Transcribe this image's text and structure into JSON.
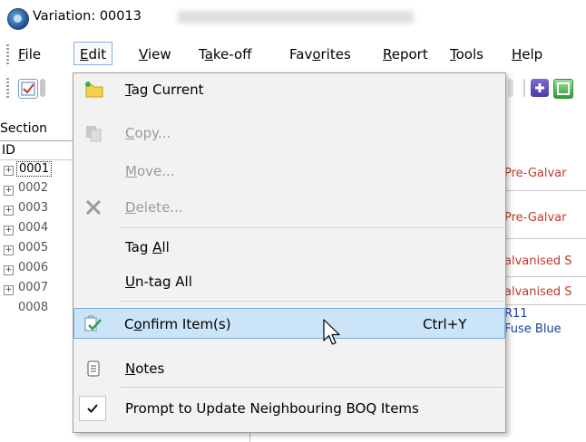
{
  "window": {
    "title": "Variation: 00013"
  },
  "menubar": {
    "items": [
      {
        "label_pre": "",
        "label_u": "F",
        "label_post": "ile"
      },
      {
        "label_pre": "",
        "label_u": "E",
        "label_post": "dit"
      },
      {
        "label_pre": "",
        "label_u": "V",
        "label_post": "iew"
      },
      {
        "label_pre": "T",
        "label_u": "a",
        "label_post": "ke-off"
      },
      {
        "label_pre": "Fav",
        "label_u": "o",
        "label_post": "rites"
      },
      {
        "label_pre": "",
        "label_u": "R",
        "label_post": "eport"
      },
      {
        "label_pre": "",
        "label_u": "T",
        "label_post": "ools"
      },
      {
        "label_pre": "",
        "label_u": "H",
        "label_post": "elp"
      }
    ]
  },
  "left_panel": {
    "section_label": "Section",
    "id_header": "ID",
    "rows": [
      {
        "id": "0001",
        "selected": true
      },
      {
        "id": "0002"
      },
      {
        "id": "0003"
      },
      {
        "id": "0004"
      },
      {
        "id": "0005"
      },
      {
        "id": "0006"
      },
      {
        "id": "0007"
      },
      {
        "id": "0008"
      }
    ]
  },
  "descriptions": [
    {
      "text": "Pre-Galvar",
      "color": "red"
    },
    {
      "text": "Pre-Galvar",
      "color": "red"
    },
    {
      "text": "alvanised S",
      "color": "red"
    },
    {
      "text": "alvanised S",
      "color": "red"
    },
    {
      "text": "R11",
      "color": "blue"
    },
    {
      "text": "Fuse Blue",
      "color": "blue"
    }
  ],
  "edit_menu": {
    "tag_current": {
      "pre": "",
      "u": "T",
      "post": "ag Current"
    },
    "copy": {
      "pre": "",
      "u": "C",
      "post": "opy..."
    },
    "move": {
      "pre": "",
      "u": "M",
      "post": "ove..."
    },
    "delete": {
      "pre": "",
      "u": "D",
      "post": "elete..."
    },
    "tag_all": {
      "pre": "Tag ",
      "u": "A",
      "post": "ll"
    },
    "untag_all": {
      "pre": "",
      "u": "U",
      "post": "n-tag All"
    },
    "confirm": {
      "pre": "C",
      "u": "o",
      "post": "nfirm Item(s)",
      "shortcut": "Ctrl+Y"
    },
    "notes": {
      "pre": "",
      "u": "N",
      "post": "otes"
    },
    "prompt": {
      "label": "Prompt to Update Neighbouring BOQ Items",
      "checked": true
    }
  },
  "colors": {
    "highlight_bg": "#cce4f7",
    "highlight_border": "#76aee3",
    "menu_bg": "#f2f2f2",
    "red_text": "#c0392b",
    "blue_text": "#1a3d99"
  }
}
